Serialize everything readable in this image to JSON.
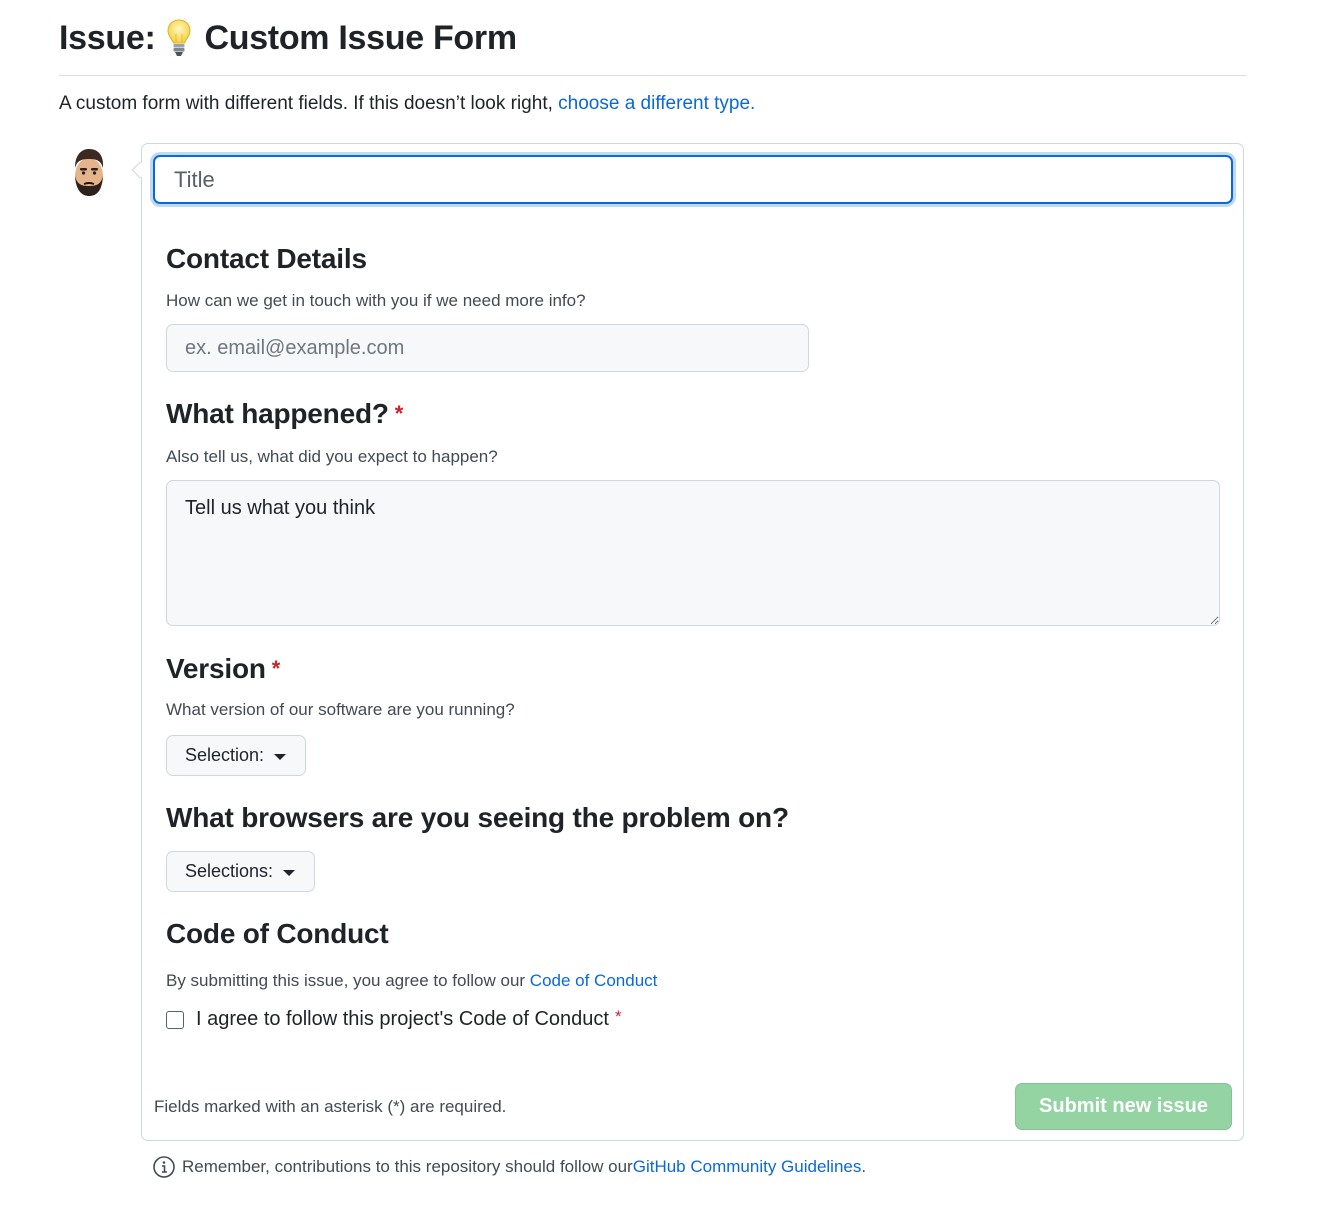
{
  "header": {
    "prefix": "Issue:",
    "icon": "light-bulb-icon",
    "title": "Custom Issue Form"
  },
  "intro": {
    "text": "A custom form with different fields. If this doesn’t look right, ",
    "link": "choose a different type."
  },
  "user": {
    "avatar": "avatar-icon"
  },
  "title_field": {
    "placeholder": "Title",
    "value": ""
  },
  "contact": {
    "title": "Contact Details",
    "description": "How can we get in touch with you if we need more info?",
    "placeholder": "ex. email@example.com",
    "value": ""
  },
  "what_happened": {
    "title": "What happened?",
    "required_mark": "*",
    "description": "Also tell us, what did you expect to happen?",
    "placeholder": "Tell us what you think",
    "value": ""
  },
  "version": {
    "title": "Version",
    "required_mark": "*",
    "description": "What version of our software are you running?",
    "button_label": "Selection:"
  },
  "browsers": {
    "title": "What browsers are you seeing the problem on?",
    "button_label": "Selections:"
  },
  "code_of_conduct": {
    "title": "Code of Conduct",
    "description": "By submitting this issue, you agree to follow our ",
    "link": "Code of Conduct",
    "checkbox_label": "I agree to follow this project's Code of Conduct",
    "required_mark": "*",
    "checked": false
  },
  "footer": {
    "required_note": "Fields marked with an asterisk (*) are required.",
    "submit_label": "Submit new issue",
    "submit_color": "#94d3a2",
    "remember_text": "Remember, contributions to this repository should follow our ",
    "remember_link": "GitHub Community Guidelines",
    "remember_end": "."
  },
  "colors": {
    "link": "#0969da",
    "required": "#cf222e",
    "focus_border": "#0969da"
  }
}
